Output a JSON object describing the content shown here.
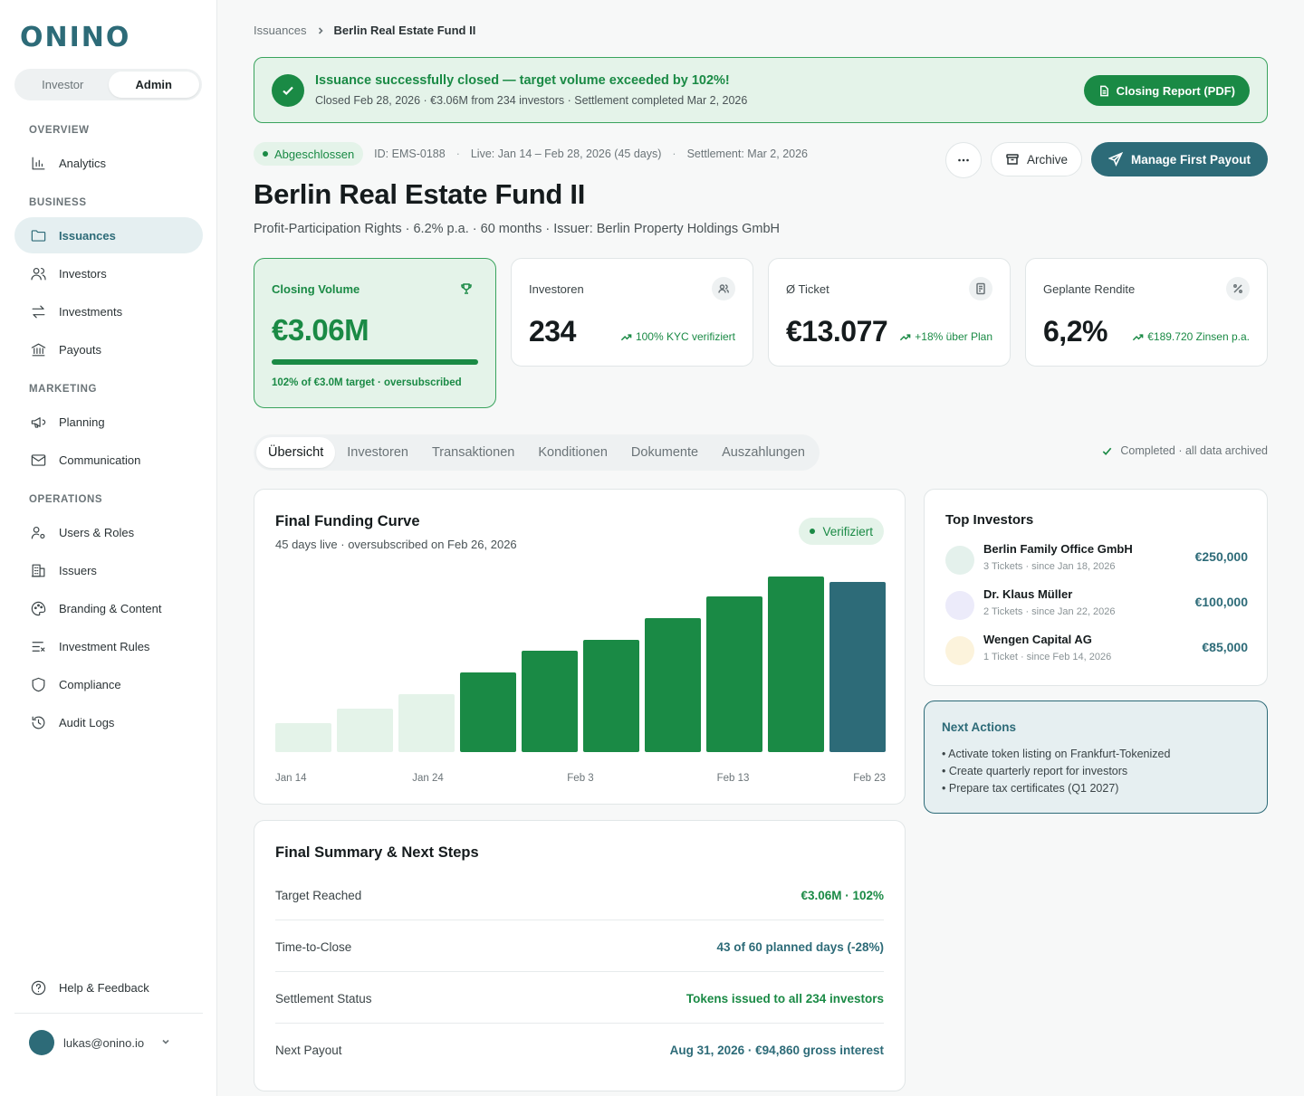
{
  "brand": "ONINO",
  "colors": {
    "accent": "#2d6b78",
    "success": "#1a8a45",
    "success_light": "#e4f3e9",
    "bar_muted": "#e4f3e9",
    "bar_final": "#2d6b78"
  },
  "sidebar": {
    "role_switch": [
      "Investor",
      "Admin"
    ],
    "role_active": "Admin",
    "sections": {
      "overview": "OVERVIEW",
      "business": "BUSINESS",
      "marketing": "MARKETING",
      "operations": "OPERATIONS"
    },
    "items": {
      "analytics": {
        "label": "Analytics",
        "icon": "bar-chart-icon"
      },
      "issuances": {
        "label": "Issuances",
        "icon": "folder-icon"
      },
      "investors": {
        "label": "Investors",
        "icon": "users-icon"
      },
      "investments": {
        "label": "Investments",
        "icon": "arrows-exchange-icon"
      },
      "payouts": {
        "label": "Payouts",
        "icon": "bank-icon"
      },
      "planning": {
        "label": "Planning",
        "icon": "megaphone-icon"
      },
      "communication": {
        "label": "Communication",
        "icon": "mail-icon"
      },
      "users_roles": {
        "label": "Users & Roles",
        "icon": "user-gear-icon"
      },
      "issuers": {
        "label": "Issuers",
        "icon": "building-icon"
      },
      "branding": {
        "label": "Branding & Content",
        "icon": "palette-icon"
      },
      "investment_rules": {
        "label": "Investment Rules",
        "icon": "list-x-icon"
      },
      "compliance": {
        "label": "Compliance",
        "icon": "shield-icon"
      },
      "audit_logs": {
        "label": "Audit Logs",
        "icon": "history-icon"
      },
      "help": {
        "label": "Help & Feedback",
        "icon": "help-circle-icon"
      }
    },
    "user_email": "lukas@onino.io"
  },
  "breadcrumb": {
    "parent": "Issuances",
    "current": "Berlin Real Estate Fund II"
  },
  "banner": {
    "title": "Issuance successfully closed — target volume exceeded by 102%!",
    "subtitle": "Closed Feb 28, 2026 · €3.06M from 234 investors · Settlement completed Mar 2, 2026",
    "button": "Closing Report (PDF)"
  },
  "meta": {
    "status": "Abgeschlossen",
    "id": "ID: EMS-0188",
    "live": "Live: Jan 14 – Feb 28, 2026 (45 days)",
    "settlement": "Settlement: Mar 2, 2026",
    "separator": "·"
  },
  "actions": {
    "archive": "Archive",
    "primary": "Manage First Payout"
  },
  "title": "Berlin Real Estate Fund II",
  "subtitle": "Profit-Participation Rights · 6.2% p.a. · 60 months · Issuer: Berlin Property Holdings GmbH",
  "kpis": {
    "closing": {
      "label": "Closing Volume",
      "value": "€3.06M",
      "progress_pct": 100,
      "caption": "102% of €3.0M target · oversubscribed"
    },
    "investors": {
      "label": "Investoren",
      "value": "234",
      "trend": "100% KYC verifiziert"
    },
    "ticket": {
      "label": "Ø Ticket",
      "value": "€13.077",
      "trend": "+18% über Plan"
    },
    "return": {
      "label": "Geplante Rendite",
      "value": "6,2%",
      "trend": "€189.720 Zinsen p.a."
    }
  },
  "tabs": [
    "Übersicht",
    "Investoren",
    "Transaktionen",
    "Konditionen",
    "Dokumente",
    "Auszahlungen"
  ],
  "tab_active": "Übersicht",
  "archived_note": "Completed · all data archived",
  "funding_curve": {
    "title": "Final Funding Curve",
    "subtitle": "45 days live · oversubscribed on Feb 26, 2026",
    "badge": "Verifiziert",
    "x_labels": [
      "Jan 14",
      "Jan 24",
      "Feb 3",
      "Feb 13",
      "Feb 23"
    ]
  },
  "chart_data": {
    "type": "bar",
    "title": "Final Funding Curve",
    "categories": [
      "1",
      "2",
      "3",
      "4",
      "5",
      "6",
      "7",
      "8",
      "9",
      "10"
    ],
    "values": [
      16,
      24,
      32,
      44,
      56,
      62,
      74,
      86,
      97,
      94
    ],
    "bar_styles": [
      "muted",
      "muted",
      "muted",
      "main",
      "main",
      "main",
      "main",
      "main",
      "main",
      "final"
    ],
    "ylim": [
      0,
      100
    ],
    "grid": false
  },
  "top_investors": {
    "title": "Top Investors",
    "rows": [
      {
        "name": "Berlin Family Office GmbH",
        "meta": "3 Tickets · since Jan 18, 2026",
        "amount": "€250,000",
        "avatar_color": "#e4f1ec"
      },
      {
        "name": "Dr. Klaus Müller",
        "meta": "2 Tickets · since Jan 22, 2026",
        "amount": "€100,000",
        "avatar_color": "#ecebfa"
      },
      {
        "name": "Wengen Capital AG",
        "meta": "1 Ticket · since Feb 14, 2026",
        "amount": "€85,000",
        "avatar_color": "#fcf3dc"
      }
    ]
  },
  "next_actions": {
    "title": "Next Actions",
    "items": [
      "Activate token listing on Frankfurt-Tokenized",
      "Create quarterly report for investors",
      "Prepare tax certificates (Q1 2027)"
    ]
  },
  "summary": {
    "title": "Final Summary & Next Steps",
    "rows": [
      {
        "label": "Target Reached",
        "value": "€3.06M · 102%",
        "color": "#1a8a45"
      },
      {
        "label": "Time-to-Close",
        "value": "43 of 60 planned days (-28%)",
        "color": "#2d6b78"
      },
      {
        "label": "Settlement Status",
        "value": "Tokens issued to all 234 investors",
        "color": "#1a8a45"
      },
      {
        "label": "Next Payout",
        "value": "Aug 31, 2026 · €94,860 gross interest",
        "color": "#2d6b78"
      }
    ]
  }
}
